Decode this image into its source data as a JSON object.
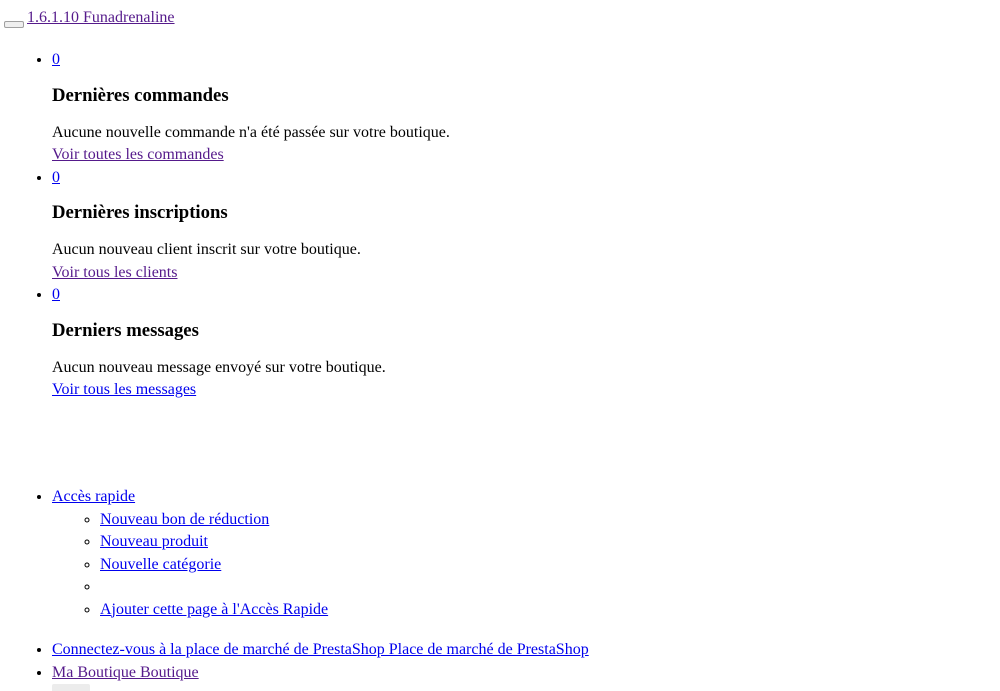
{
  "header": {
    "version_link": "1.6.1.10 Funadrenaline"
  },
  "notifications": [
    {
      "count": "0",
      "title": "Dernières commandes",
      "message": "Aucune nouvelle commande n'a été passée sur votre boutique.",
      "link": "Voir toutes les commandes"
    },
    {
      "count": "0",
      "title": "Dernières inscriptions",
      "message": "Aucun nouveau client inscrit sur votre boutique.",
      "link": "Voir tous les clients"
    },
    {
      "count": "0",
      "title": "Derniers messages",
      "message": "Aucun nouveau message envoyé sur votre boutique.",
      "link": "Voir tous les messages"
    }
  ],
  "quick_access": {
    "label": "Accès rapide",
    "items": [
      "Nouveau bon de réduction",
      "Nouveau produit",
      "Nouvelle catégorie",
      "",
      "Ajouter cette page à l'Accès Rapide"
    ]
  },
  "footer_links": {
    "marketplace": "Connectez-vous à la place de marché de PrestaShop Place de marché de PrestaShop",
    "shop": "Ma Boutique Boutique"
  },
  "colors": {
    "link": "#0000ee",
    "visited": "#551a8b"
  }
}
